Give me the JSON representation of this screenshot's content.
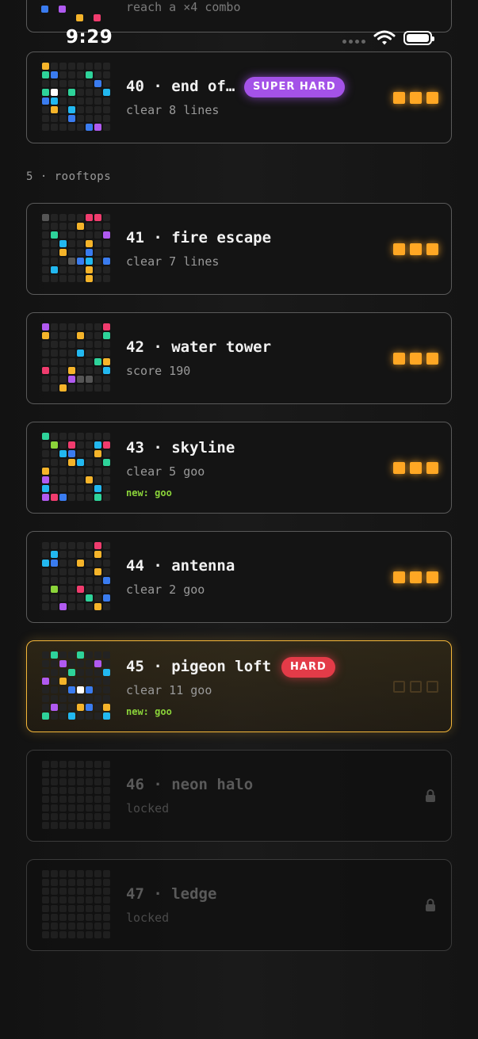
{
  "status_bar": {
    "time": "9:29"
  },
  "section": {
    "label": "5 · rooftops"
  },
  "colors": {
    "accent": "#ffa724",
    "super_hard": "#a452e8",
    "hard": "#e33b48",
    "new": "#8bd43a",
    "pink": "#f03c6e",
    "purple": "#b05af0",
    "blue": "#3a7cf0",
    "cyan": "#22b8f0",
    "green": "#2ed39a",
    "lime": "#8bd43a",
    "yellow": "#f5b42a",
    "gray": "#555555",
    "white": "#ffffff"
  },
  "partial_card": {
    "subtitle": "reach a ×4 combo"
  },
  "levels": [
    {
      "title": "40 · end of…",
      "subtitle": "clear 8 lines",
      "badge": "SUPER HARD",
      "badge_type": "super",
      "stars": 3,
      "state": "complete",
      "cells": [
        "y,,,,,,,",
        "g,b,,,,g,,",
        ",,,,,,b,",
        "g,w,,g,,,,c",
        "b,c,,,,,,",
        ",y,,c,,,,",
        ",,,b,,,,",
        ",,,,,b,p,"
      ]
    },
    {
      "title": "41 · fire escape",
      "subtitle": "clear 7 lines",
      "stars": 3,
      "state": "complete",
      "cells": [
        "G,,,,,k,k,",
        ",,,,y,,,",
        ",g,,,,,,p",
        ",,c,,,y,,",
        ",,y,,,b,,",
        ",,,G,b,c,,b",
        ",c,,,,y,,",
        ",,,,,y,,"
      ]
    },
    {
      "title": "42 · water tower",
      "subtitle": "score 190",
      "stars": 3,
      "state": "complete",
      "cells": [
        "p,,,,,,,k",
        "y,,,,y,,,g",
        ",,,,,,,",
        ",,,,c,,,",
        ",,,,,,g,y",
        "k,,,y,,,,c",
        ",,,p,G,G,,",
        ",,y,,,,,"
      ]
    },
    {
      "title": "43 · skyline",
      "subtitle": "clear 5 goo",
      "newtag": "new: goo",
      "stars": 3,
      "state": "complete",
      "cells": [
        "g,,,,,,,",
        ",l,,k,,,c,k",
        ",,c,b,,,y,",
        ",,,y,c,,,g",
        "y,,,,,,,",
        "p,,,,,y,,",
        "c,,,,,,c,",
        "p,k,b,,,,g,"
      ]
    },
    {
      "title": "44 · antenna",
      "subtitle": "clear 2 goo",
      "stars": 3,
      "state": "complete",
      "cells": [
        ",,,,,,k,",
        ",c,,,,,y,",
        "c,b,,,y,,,",
        ",,,,,,y,",
        ",,,,,,,b",
        ",l,,,k,,,",
        ",,,,,g,,b",
        ",,p,,,,y,"
      ]
    },
    {
      "title": "45 · pigeon loft",
      "subtitle": "clear 11 goo",
      "newtag": "new: goo",
      "badge": "HARD",
      "badge_type": "hard",
      "stars": 0,
      "state": "active",
      "cells": [
        ",g,,,g,,,",
        ",,p,,,,p,",
        ",,,g,,,,c",
        "p,,y,,,,,",
        ",,,b,w,b,,",
        ",,,,,,,",
        ",p,,,y,b,,y",
        "g,,,c,,,,c"
      ]
    },
    {
      "title": "46 · neon halo",
      "subtitle": "locked",
      "state": "locked",
      "cells": [
        ",,,,,,,",
        ",,,,,,,",
        ",,,,,,,",
        ",,,,,,,",
        ",,,,,,,",
        ",,,,,,,",
        ",,,,,,,",
        ",,,,,,,"
      ]
    },
    {
      "title": "47 · ledge",
      "subtitle": "locked",
      "state": "locked",
      "cells": [
        ",,,,,,,",
        ",,,,,,,",
        ",,,,,,,",
        ",,,,,,,",
        ",,,,,,,",
        ",,,,,,,",
        ",,,,,,,",
        ",,,,,,,"
      ]
    }
  ]
}
